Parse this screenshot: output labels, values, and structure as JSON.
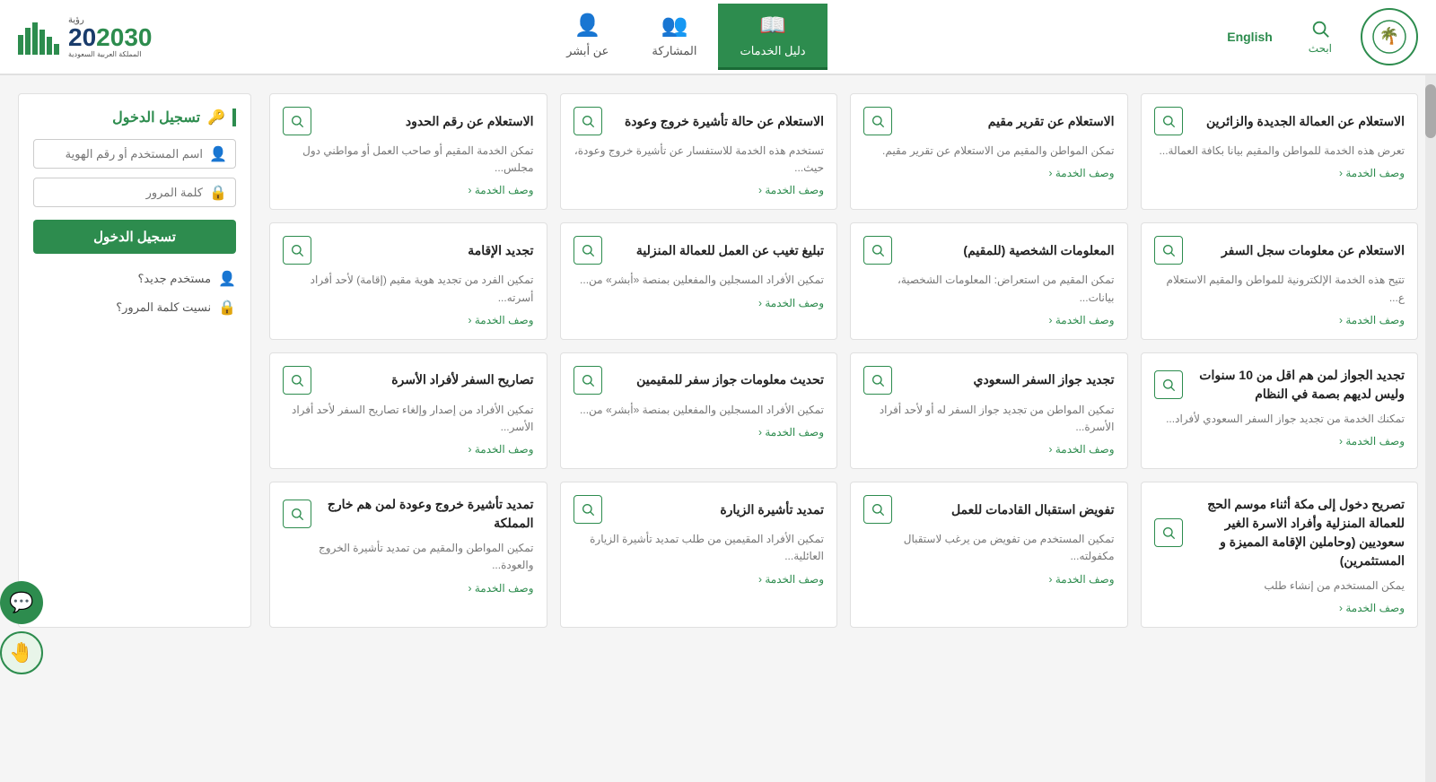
{
  "header": {
    "logo_alt": "Saudi Government Logo",
    "search_label": "ابحث",
    "english_label": "English",
    "nav": [
      {
        "id": "daleel",
        "label": "دليل الخدمات",
        "icon": "📖",
        "active": true
      },
      {
        "id": "musharaka",
        "label": "المشاركة",
        "icon": "👥",
        "active": false
      },
      {
        "id": "abshir",
        "label": "عن أبشر",
        "icon": "👤",
        "active": false
      }
    ],
    "vision_label": "رؤية",
    "vision_year": "2030",
    "vision_sub": "المملكة العربية السعودية"
  },
  "sidebar": {
    "title": "تسجيل الدخول",
    "username_placeholder": "اسم المستخدم أو رقم الهوية",
    "password_placeholder": "كلمة المرور",
    "login_button": "تسجيل الدخول",
    "new_user_label": "مستخدم جديد؟",
    "forgot_password_label": "نسيت كلمة المرور؟"
  },
  "cards": [
    {
      "title": "الاستعلام عن العمالة الجديدة والزائرين",
      "desc": "تعرض هذه الخدمة للمواطن والمقيم بيانا بكافة العمالة...",
      "link": "وصف الخدمة ‹"
    },
    {
      "title": "الاستعلام عن تقرير مقيم",
      "desc": "تمكن المواطن والمقيم من الاستعلام عن تقرير مقيم.",
      "link": "وصف الخدمة ‹"
    },
    {
      "title": "الاستعلام عن حالة تأشيرة خروج وعودة",
      "desc": "تستخدم هذه الخدمة للاستفسار عن تأشيرة خروج وعودة، حيث...",
      "link": "وصف الخدمة ‹"
    },
    {
      "title": "الاستعلام عن رقم الحدود",
      "desc": "تمكن الخدمة المقيم أو صاحب العمل أو مواطني دول مجلس...",
      "link": "وصف الخدمة ‹"
    },
    {
      "title": "الاستعلام عن معلومات سجل السفر",
      "desc": "تتيح هذه الخدمة الإلكترونية للمواطن والمقيم الاستعلام ع...",
      "link": "وصف الخدمة ‹"
    },
    {
      "title": "المعلومات الشخصية (للمقيم)",
      "desc": "تمكن المقيم من استعراض: المعلومات الشخصية، بيانات...",
      "link": "وصف الخدمة ‹"
    },
    {
      "title": "تبليغ تغيب عن العمل للعمالة المنزلية",
      "desc": "تمكين الأفراد المسجلين والمفعلين بمنصة «أبشر» من...",
      "link": "وصف الخدمة ‹"
    },
    {
      "title": "تجديد الإقامة",
      "desc": "تمكين الفرد من تجديد هوية مقيم (إقامة) لأحد أفراد أسرته...",
      "link": "وصف الخدمة ‹"
    },
    {
      "title": "تجديد الجواز لمن هم اقل من 10 سنوات وليس لديهم بصمة في النظام",
      "desc": "تمكنك الخدمة من تجديد جواز السفر السعودي لأفراد...",
      "link": "وصف الخدمة ‹"
    },
    {
      "title": "تجديد جواز السفر السعودي",
      "desc": "تمكين المواطن من تجديد جواز السفر له أو لأحد أفراد الأسرة...",
      "link": "وصف الخدمة ‹"
    },
    {
      "title": "تحديث معلومات جواز سفر للمقيمين",
      "desc": "تمكين الأفراد المسجلين والمفعلين بمنصة «أبشر» من...",
      "link": "وصف الخدمة ‹"
    },
    {
      "title": "تصاريح السفر لأفراد الأسرة",
      "desc": "تمكين الأفراد من إصدار وإلغاء تصاريح السفر لأحد أفراد الأسر...",
      "link": "وصف الخدمة ‹"
    },
    {
      "title": "تصريح دخول إلى مكة أثناء موسم الحج للعمالة المنزلية وأفراد الاسرة الغير سعوديين (وحاملين الإقامة المميزة و المستثمرين)",
      "desc": "يمكن المستخدم من إنشاء طلب",
      "link": "وصف الخدمة ‹"
    },
    {
      "title": "تفويض استقبال القادمات للعمل",
      "desc": "تمكين المستخدم من تفويض من يرغب لاستقبال مكفولته...",
      "link": "وصف الخدمة ‹"
    },
    {
      "title": "تمديد تأشيرة الزيارة",
      "desc": "تمكين الأفراد المقيمين من طلب تمديد تأشيرة الزيارة العائلية...",
      "link": "وصف الخدمة ‹"
    },
    {
      "title": "تمديد تأشيرة خروج وعودة لمن هم خارج المملكة",
      "desc": "تمكين المواطن والمقيم من تمديد تأشيرة الخروج والعودة...",
      "link": "وصف الخدمة ‹"
    }
  ],
  "float_buttons": {
    "chat_icon": "💬",
    "help_icon": "🤚"
  }
}
